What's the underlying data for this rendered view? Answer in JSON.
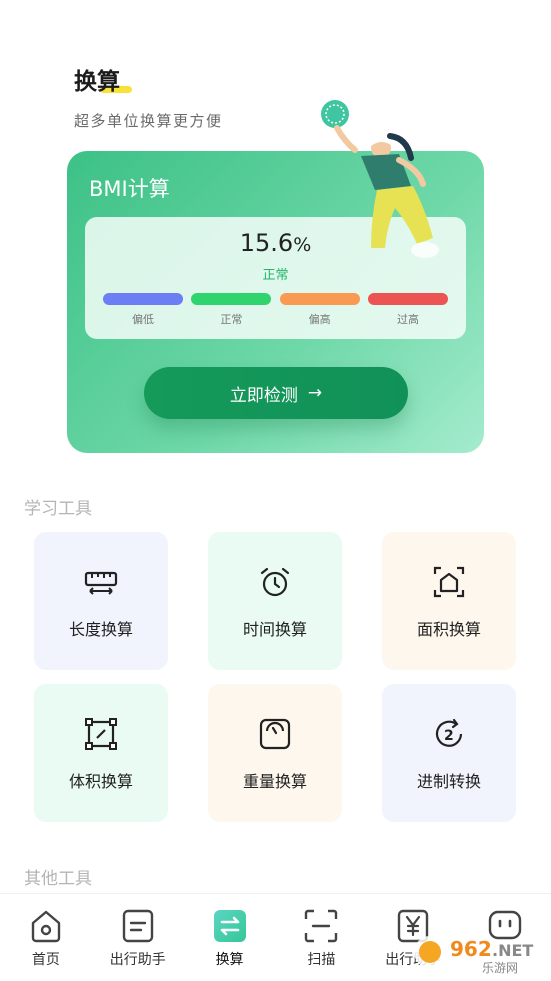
{
  "header": {
    "title": "换算",
    "subtitle": "超多单位换算更方便"
  },
  "bmi": {
    "title": "BMI计算",
    "value": "15.6",
    "unit": "%",
    "status": "正常",
    "scale": [
      {
        "label": "偏低",
        "color": "#6b7ef3"
      },
      {
        "label": "正常",
        "color": "#2fd46f"
      },
      {
        "label": "偏高",
        "color": "#f89a52"
      },
      {
        "label": "过高",
        "color": "#ec5454"
      }
    ],
    "button_label": "立即检测",
    "button_arrow": "→"
  },
  "sections": {
    "study_tools": "学习工具",
    "other_tools": "其他工具"
  },
  "tools": [
    {
      "label": "长度换算",
      "icon": "ruler-icon"
    },
    {
      "label": "时间换算",
      "icon": "alarm-clock-icon"
    },
    {
      "label": "面积换算",
      "icon": "area-house-icon"
    },
    {
      "label": "体积换算",
      "icon": "volume-box-icon"
    },
    {
      "label": "重量换算",
      "icon": "scale-weight-icon"
    },
    {
      "label": "进制转换",
      "icon": "base-convert-icon"
    }
  ],
  "tabbar": [
    {
      "label": "首页",
      "icon": "home-icon"
    },
    {
      "label": "出行助手",
      "icon": "document-icon"
    },
    {
      "label": "换算",
      "icon": "convert-icon",
      "active": true
    },
    {
      "label": "扫描",
      "icon": "scan-icon"
    },
    {
      "label": "出行助手",
      "icon": "yen-icon"
    },
    {
      "label": "",
      "icon": "chat-icon"
    }
  ],
  "watermark": {
    "text": "962.NET",
    "sub": "乐游网"
  },
  "colors": {
    "accent": "#1a9a5e",
    "active_tab": "#43d1b0"
  }
}
